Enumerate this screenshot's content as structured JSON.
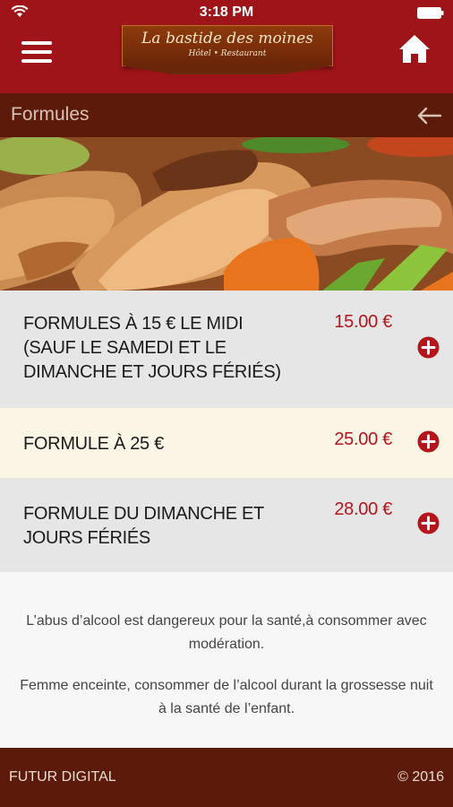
{
  "status": {
    "time": "3:18 PM"
  },
  "header": {
    "logo_name": "La bastide des moines",
    "logo_subtitle": "Hôtel • Restaurant"
  },
  "section": {
    "title": "Formules"
  },
  "formules": [
    {
      "title": "FORMULES À 15 € LE MIDI (SAUF LE SAMEDI ET LE DIMANCHE ET JOURS FÉRIÉS)",
      "price": "15.00 €"
    },
    {
      "title": "FORMULE À 25 €",
      "price": "25.00 €"
    },
    {
      "title": "FORMULE DU DIMANCHE ET JOURS FÉRIÉS",
      "price": "28.00 €"
    }
  ],
  "disclaimer": {
    "line1": "L’abus d’alcool est dangereux pour la santé,à consommer avec modération.",
    "line2": "Femme enceinte, consommer de l’alcool durant la grossesse nuit à la santé de l’enfant."
  },
  "footer": {
    "left": "FUTUR DIGITAL",
    "right": "© 2016"
  },
  "colors": {
    "brand_red": "#9e1418",
    "brand_brown": "#5c1a0a",
    "price_red": "#b3151c",
    "row_grey": "#e6e6e6",
    "row_cream": "#fbf5e6"
  }
}
